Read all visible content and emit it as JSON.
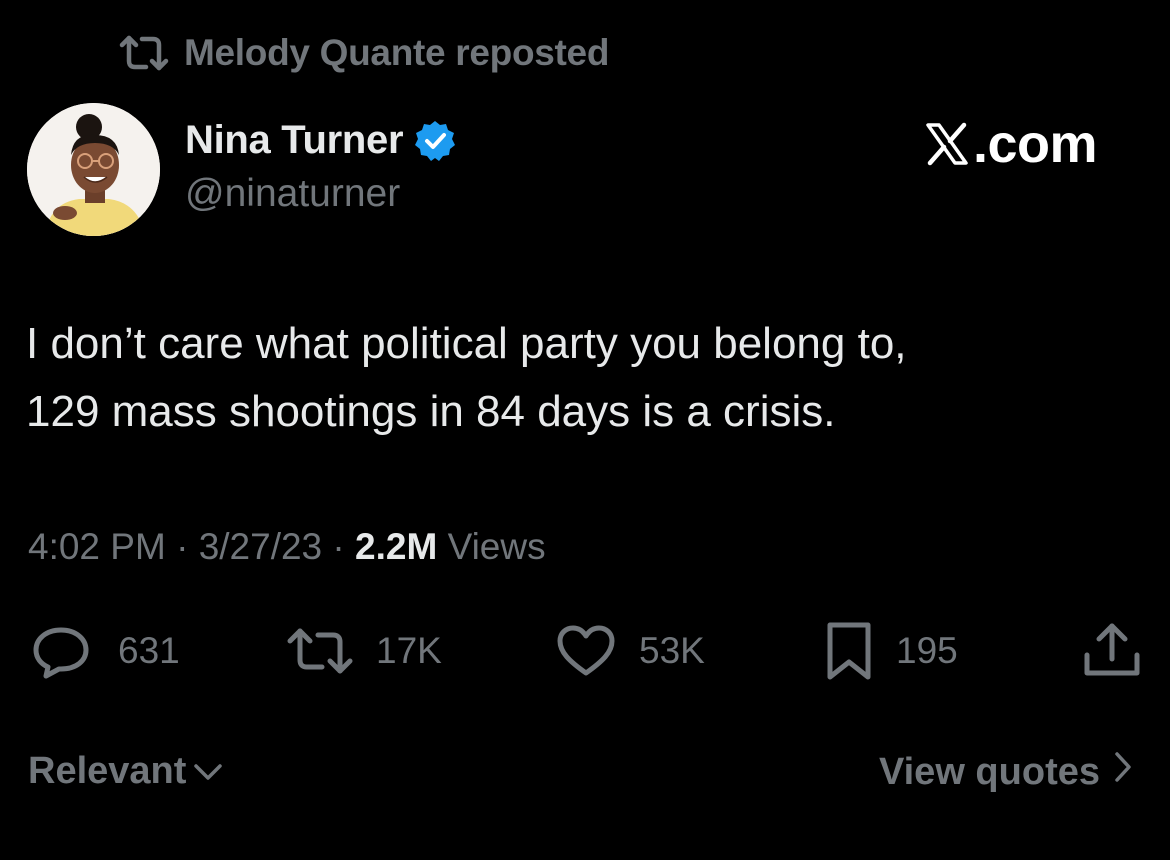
{
  "repost": {
    "text": "Melody Quante reposted",
    "icon": "repost-icon"
  },
  "author": {
    "display_name": "Nina Turner",
    "handle": "@ninaturner",
    "verified": true,
    "verified_color": "#1d9bf0",
    "avatar_icon": "avatar"
  },
  "watermark": {
    "logo": "x-logo",
    "text": ".com"
  },
  "tweet": {
    "lines": [
      "I don’t care what political party you belong to,",
      "129 mass shootings in 84 days is a crisis."
    ]
  },
  "meta": {
    "time": "4:02 PM",
    "sep1": " · ",
    "date": "3/27/23",
    "sep2": " · ",
    "views_count": "2.2M",
    "views_label": " Views"
  },
  "actions": {
    "replies": "631",
    "reposts": "17K",
    "likes": "53K",
    "bookmarks": "195"
  },
  "footer": {
    "sort_label": "Relevant",
    "view_quotes_label": "View quotes"
  },
  "colors": {
    "background": "#000000",
    "primary_text": "#e7e9ea",
    "secondary_text": "#71767b",
    "accent": "#1d9bf0"
  }
}
